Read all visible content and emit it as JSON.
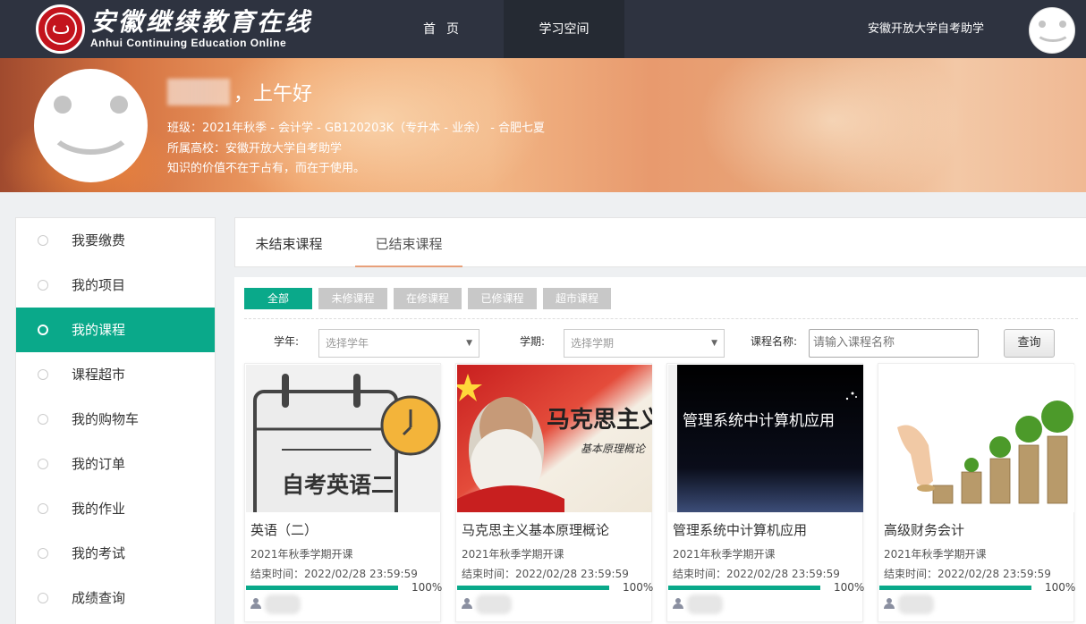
{
  "header": {
    "logo_cn": "安徽继续教育在线",
    "logo_en": "Anhui Continuing Education Online",
    "nav": [
      {
        "label": "首页"
      },
      {
        "label": "学习空间"
      }
    ],
    "school": "安徽开放大学自考助学"
  },
  "profile": {
    "greeting": "，上午好",
    "class_line": "班级：2021年秋季 - 会计学 - GB120203K（专升本 - 业余） - 合肥七夏",
    "school_line": "所属高校：安徽开放大学自考助学",
    "motto": "知识的价值不在于占有，而在于使用。"
  },
  "sidebar": {
    "items": [
      {
        "label": "我要缴费"
      },
      {
        "label": "我的项目"
      },
      {
        "label": "我的课程",
        "active": true
      },
      {
        "label": "课程超市"
      },
      {
        "label": "我的购物车"
      },
      {
        "label": "我的订单"
      },
      {
        "label": "我的作业"
      },
      {
        "label": "我的考试"
      },
      {
        "label": "成绩查询"
      }
    ]
  },
  "tabs": [
    {
      "label": "未结束课程"
    },
    {
      "label": "已结束课程",
      "active": true
    }
  ],
  "filters": {
    "buttons": [
      "全部",
      "未修课程",
      "在修课程",
      "已修课程",
      "超市课程"
    ],
    "year_label": "学年:",
    "year_placeholder": "选择学年",
    "term_label": "学期:",
    "term_placeholder": "选择学期",
    "name_label": "课程名称:",
    "name_placeholder": "请输入课程名称",
    "search_label": "查询"
  },
  "courses": [
    {
      "title": "英语（二）",
      "term": "2021年秋季学期开课",
      "end": "结束时间：2022/02/28 23:59:59",
      "progress": "100%",
      "thumb_text": "自考英语二"
    },
    {
      "title": "马克思主义基本原理概论",
      "term": "2021年秋季学期开课",
      "end": "结束时间：2022/02/28 23:59:59",
      "progress": "100%",
      "thumb_text": "马克思主义",
      "thumb_sub": "基本原理概论"
    },
    {
      "title": "管理系统中计算机应用",
      "term": "2021年秋季学期开课",
      "end": "结束时间：2022/02/28 23:59:59",
      "progress": "100%",
      "thumb_text": "管理系统中计算机应用"
    },
    {
      "title": "高级财务会计",
      "term": "2021年秋季学期开课",
      "end": "结束时间：2022/02/28 23:59:59",
      "progress": "100%"
    }
  ],
  "colors": {
    "accent": "#0aa98a",
    "topbar": "#2e3340",
    "tab_underline": "#e8a07a"
  }
}
